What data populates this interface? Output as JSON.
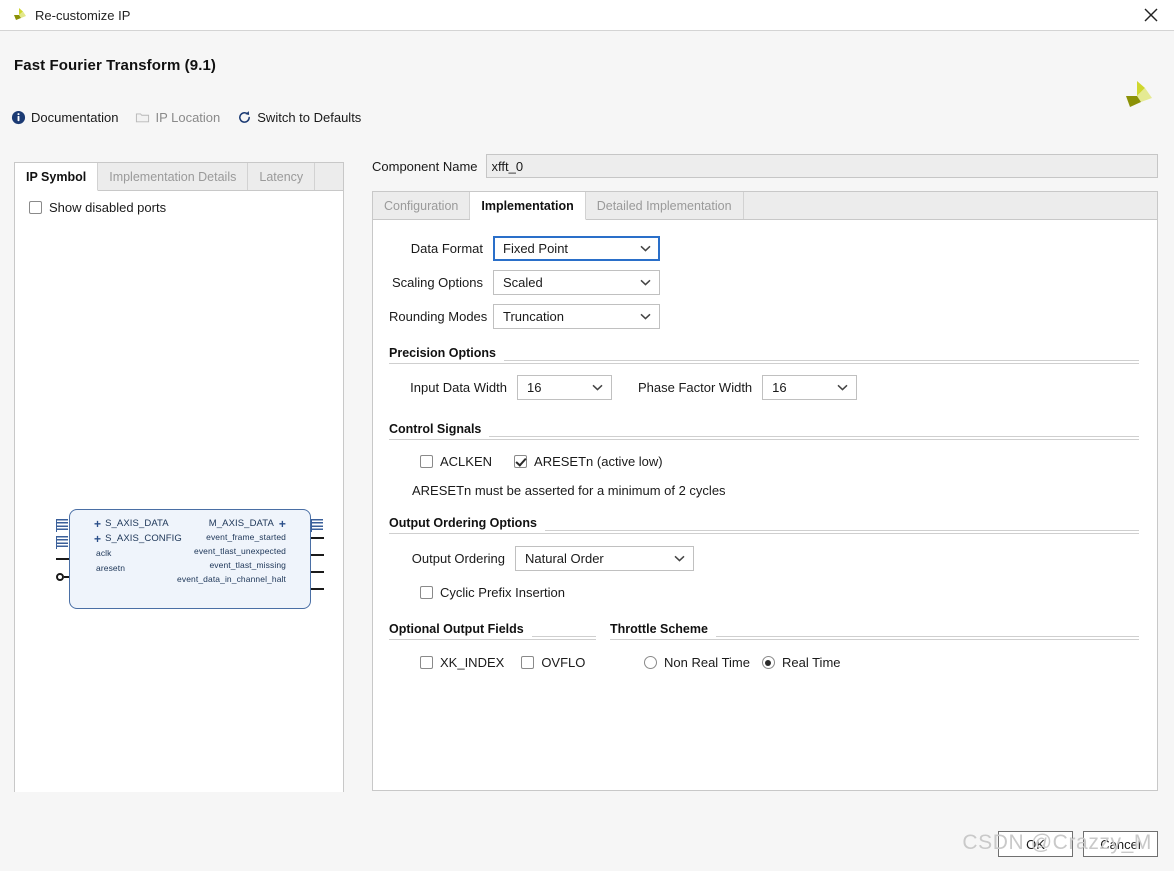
{
  "window": {
    "title": "Re-customize IP",
    "close_icon": "close-icon",
    "logo_icon": "xilinx-logo-icon"
  },
  "header": {
    "title": "Fast Fourier Transform (9.1)",
    "logo_icon": "xilinx-logo-icon",
    "toolbar": [
      {
        "label": "Documentation",
        "icon": "info-icon",
        "disabled": false
      },
      {
        "label": "IP Location",
        "icon": "folder-icon",
        "disabled": true
      },
      {
        "label": "Switch to Defaults",
        "icon": "refresh-icon",
        "disabled": false
      }
    ]
  },
  "left_panel": {
    "tabs": [
      {
        "label": "IP Symbol",
        "active": true
      },
      {
        "label": "Implementation Details",
        "active": false
      },
      {
        "label": "Latency",
        "active": false
      }
    ],
    "show_disabled_ports": {
      "label": "Show disabled ports",
      "checked": false
    },
    "symbol": {
      "left_ports": [
        {
          "name": "S_AXIS_DATA",
          "type": "bus"
        },
        {
          "name": "S_AXIS_CONFIG",
          "type": "bus"
        },
        {
          "name": "aclk",
          "type": "pin"
        },
        {
          "name": "aresetn",
          "type": "pin-inverted"
        }
      ],
      "right_ports": [
        {
          "name": "M_AXIS_DATA",
          "type": "bus"
        },
        {
          "name": "event_frame_started",
          "type": "pin"
        },
        {
          "name": "event_tlast_unexpected",
          "type": "pin"
        },
        {
          "name": "event_tlast_missing",
          "type": "pin"
        },
        {
          "name": "event_data_in_channel_halt",
          "type": "pin"
        }
      ]
    }
  },
  "right_panel": {
    "component_name": {
      "label": "Component Name",
      "value": "xfft_0"
    },
    "tabs": [
      {
        "label": "Configuration",
        "active": false
      },
      {
        "label": "Implementation",
        "active": true
      },
      {
        "label": "Detailed Implementation",
        "active": false
      }
    ],
    "fields": {
      "data_format": {
        "label": "Data Format",
        "value": "Fixed Point",
        "focused": true
      },
      "scaling_options": {
        "label": "Scaling Options",
        "value": "Scaled",
        "focused": false
      },
      "rounding_modes": {
        "label": "Rounding Modes",
        "value": "Truncation",
        "focused": false
      }
    },
    "precision_options": {
      "title": "Precision Options",
      "input_data_width": {
        "label": "Input Data Width",
        "value": "16"
      },
      "phase_factor_width": {
        "label": "Phase Factor Width",
        "value": "16"
      }
    },
    "control_signals": {
      "title": "Control Signals",
      "aclken": {
        "label": "ACLKEN",
        "checked": false
      },
      "aresetn": {
        "label": "ARESETn (active low)",
        "checked": true
      },
      "note": "ARESETn must be asserted for a minimum of 2 cycles"
    },
    "output_ordering_options": {
      "title": "Output Ordering Options",
      "output_ordering": {
        "label": "Output Ordering",
        "value": "Natural Order"
      },
      "cyclic_prefix_insertion": {
        "label": "Cyclic Prefix Insertion",
        "checked": false
      }
    },
    "optional_output_fields": {
      "title": "Optional Output Fields",
      "xk_index": {
        "label": "XK_INDEX",
        "checked": false
      },
      "ovflo": {
        "label": "OVFLO",
        "checked": false
      }
    },
    "throttle_scheme": {
      "title": "Throttle Scheme",
      "non_real_time": {
        "label": "Non Real Time",
        "selected": false
      },
      "real_time": {
        "label": "Real Time",
        "selected": true
      }
    }
  },
  "footer": {
    "ok_label": "OK",
    "cancel_label": "Cancel"
  },
  "watermark": "CSDN @Crazzy_M"
}
